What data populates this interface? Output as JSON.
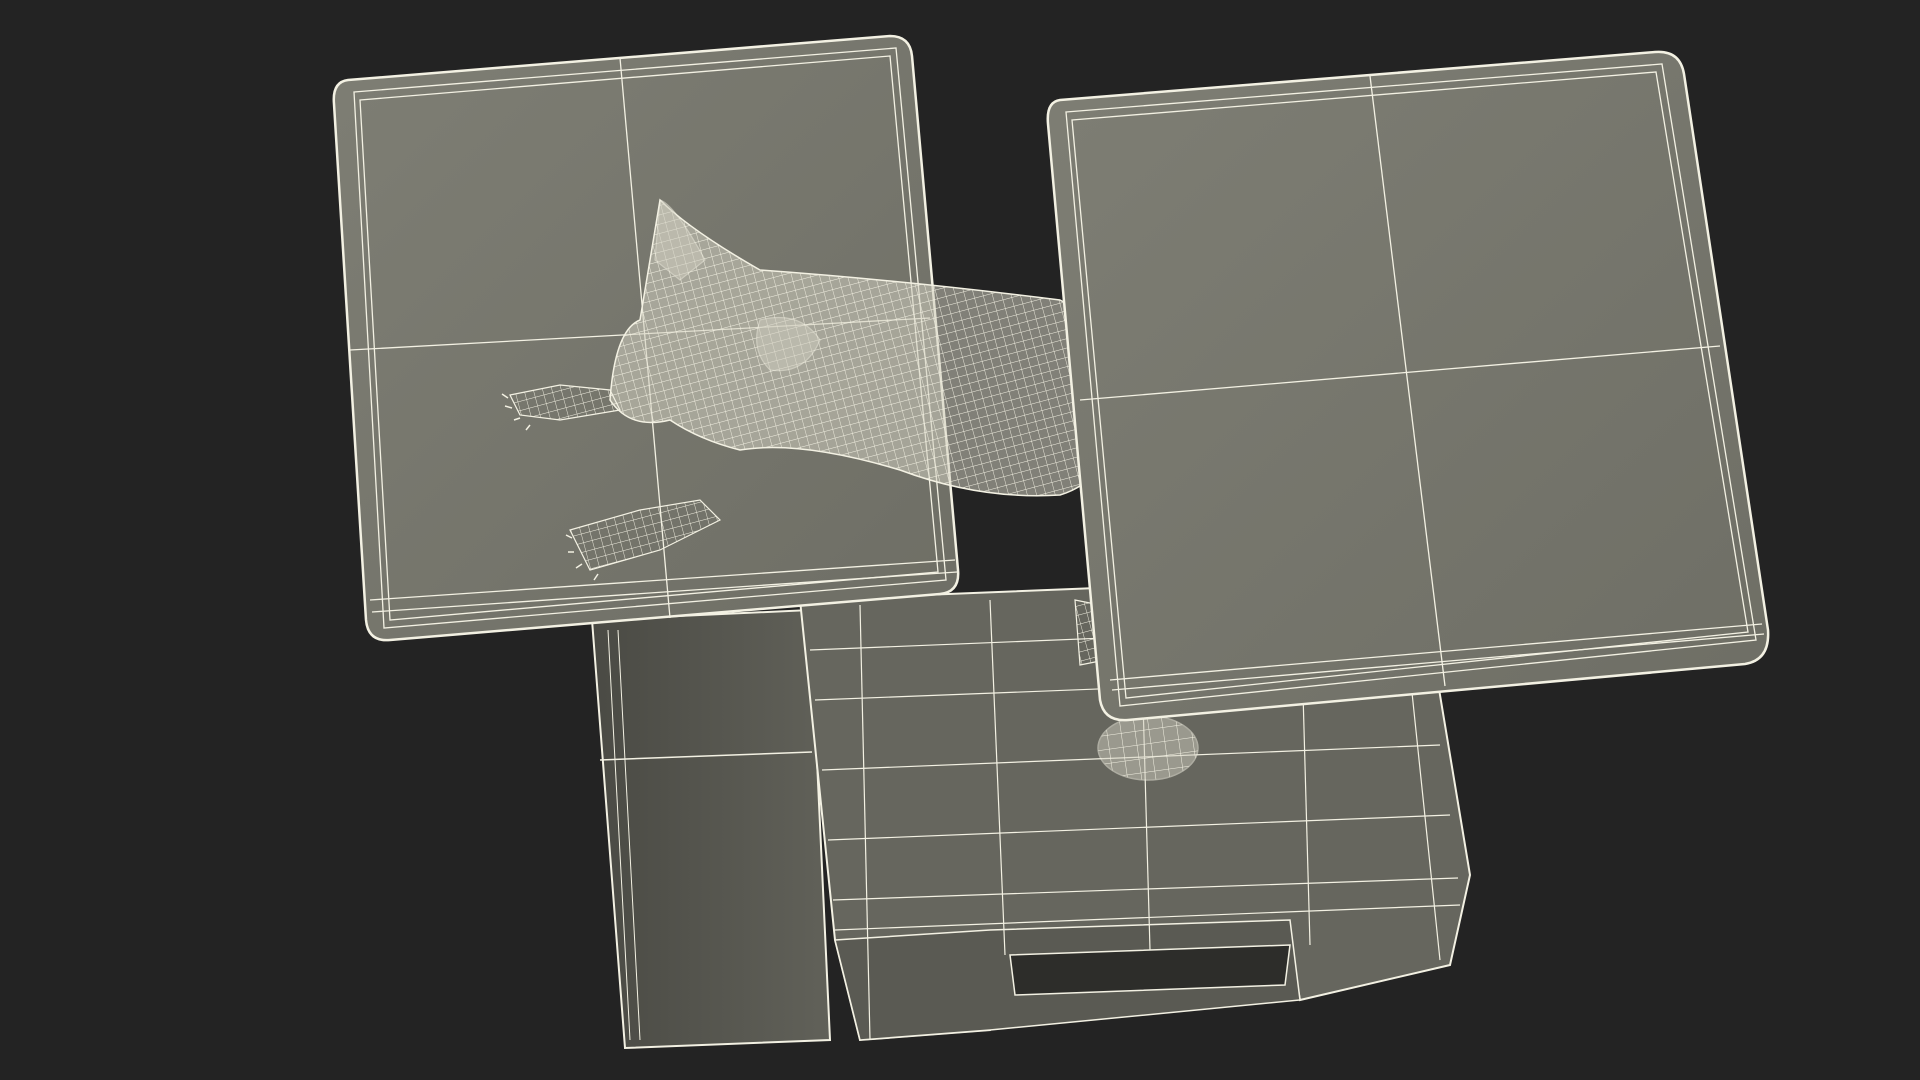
{
  "scene": {
    "description_visible_text": "",
    "colors": {
      "background": "#232323",
      "panel_fill": "#77776d",
      "panel_shadow": "#5c5c54",
      "wire": "#f3f1e3",
      "animal_fill": "#cfcdbf"
    }
  }
}
